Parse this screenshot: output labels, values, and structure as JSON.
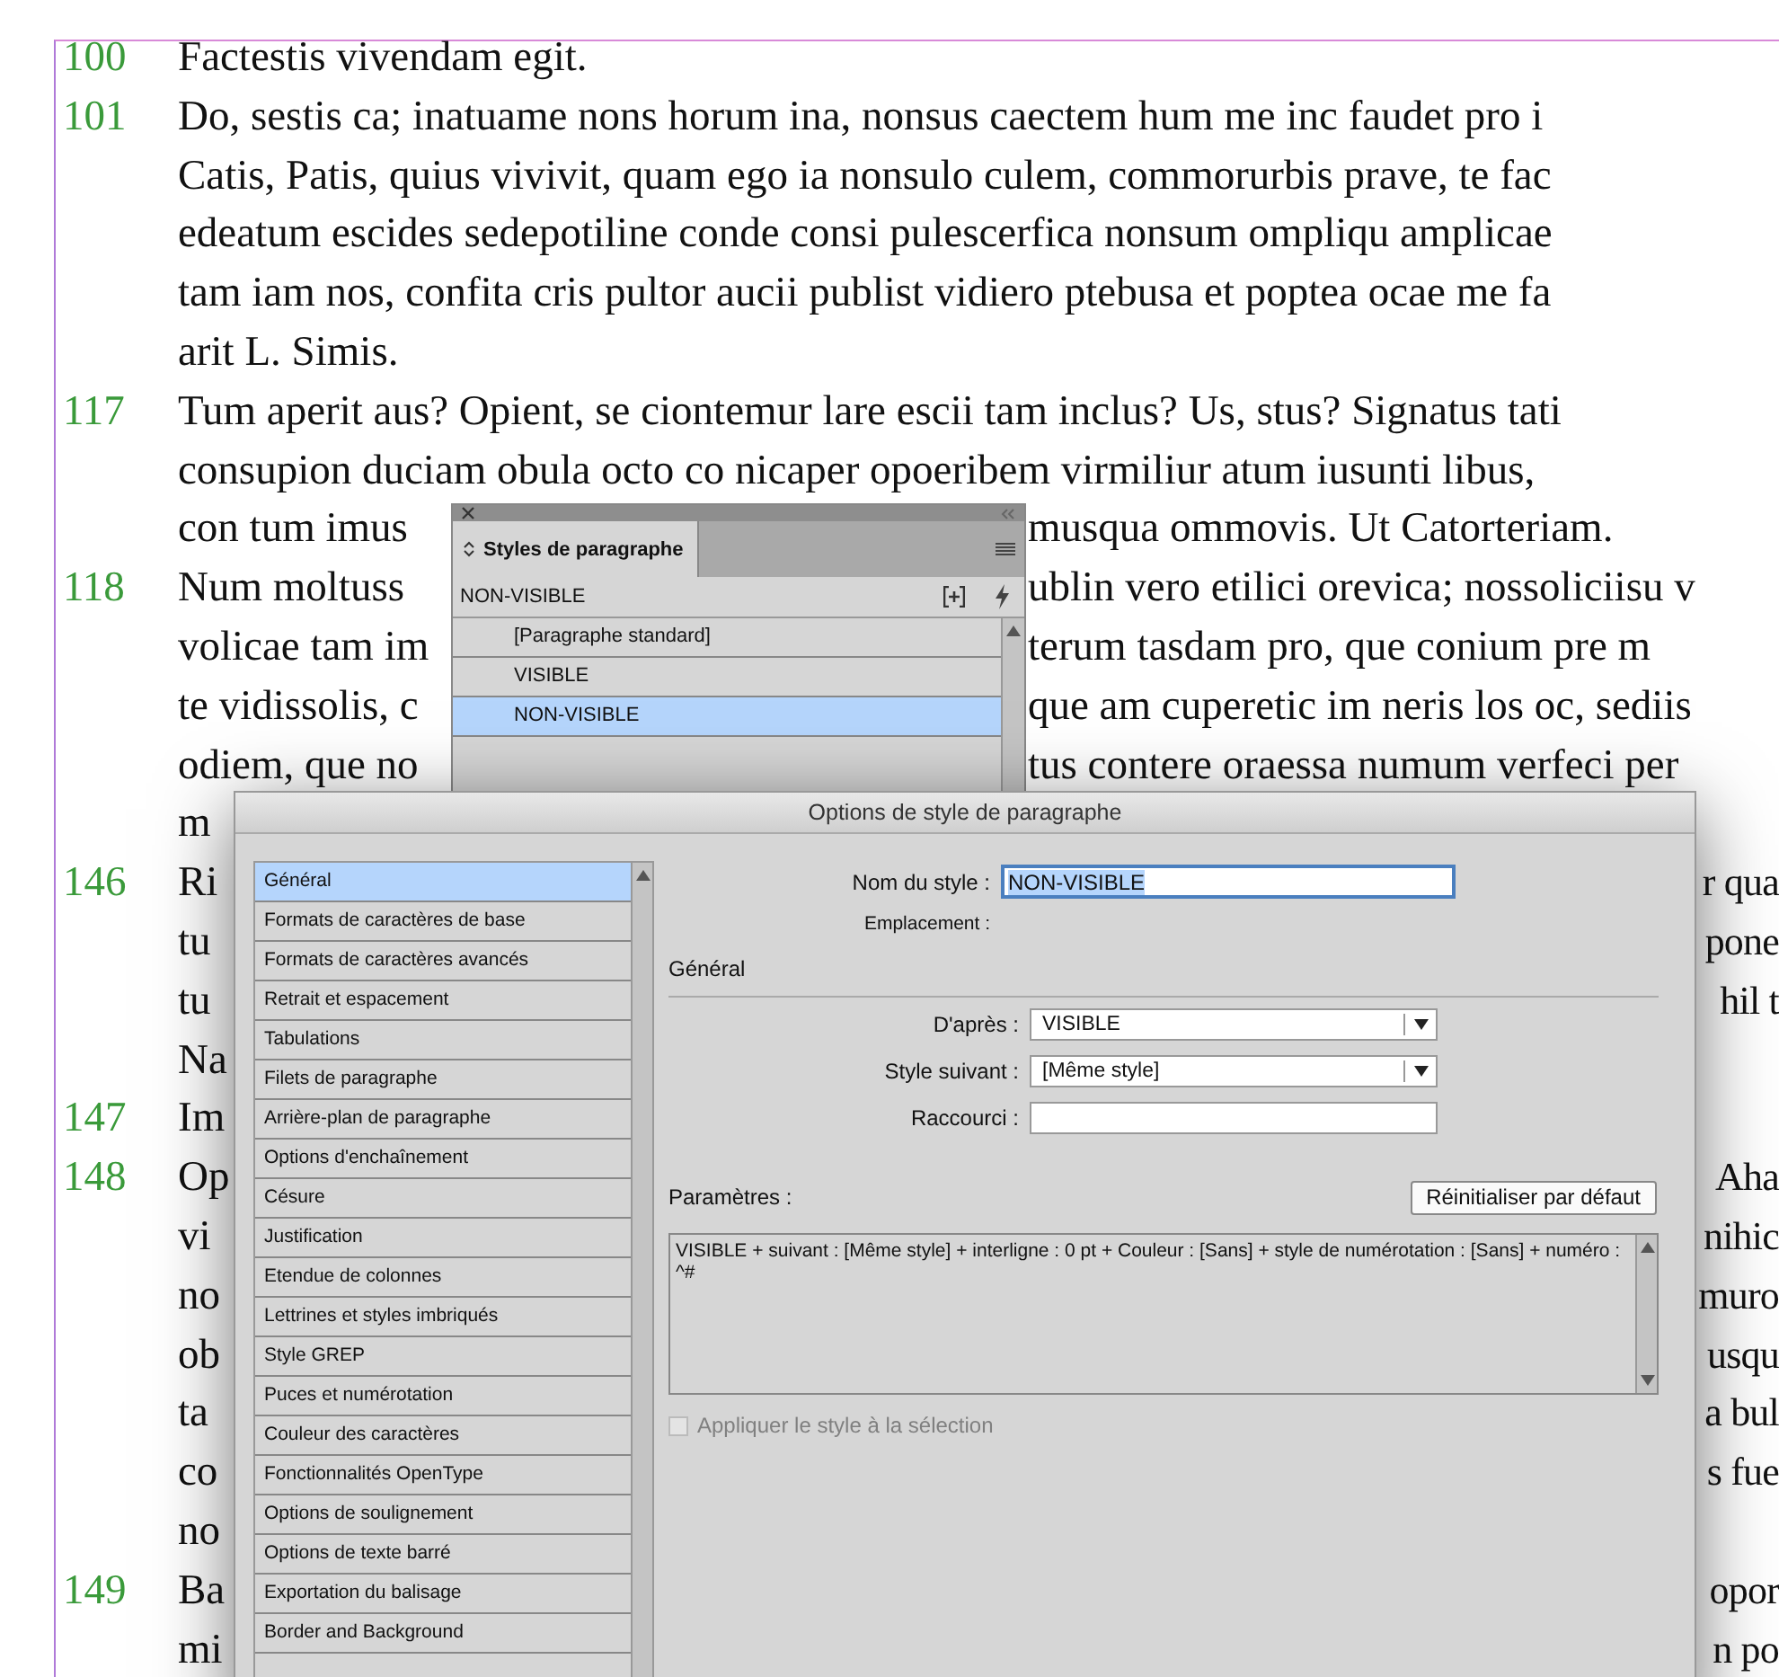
{
  "document": {
    "lines": [
      {
        "kind": "full",
        "number": "100",
        "text": "Factestis vivendam egit."
      },
      {
        "kind": "full",
        "number": "101",
        "text": "Do, sestis ca; inatuame nons horum ina, nonsus caectem hum me inc faudet pro i"
      },
      {
        "kind": "full",
        "text": "Catis, Patis, quius vivivit, quam ego ia nonsulo culem, commorurbis prave, te fac"
      },
      {
        "kind": "full",
        "text": "edeatum escides sedepotiline conde consi pulescerfica nonsum ompliqu amplicae"
      },
      {
        "kind": "full",
        "text": "tam iam nos, confita cris pultor aucii publist vidiero ptebusa et poptea ocae me fa"
      },
      {
        "kind": "full",
        "text": "arit L. Simis."
      },
      {
        "kind": "full",
        "number": "117",
        "text": "Tum aperit aus? Opient, se ciontemur lare escii tam inclus? Us, stus? Signatus tati"
      },
      {
        "kind": "full",
        "text": "consupion duciam obula octo co nicaper opoeribem virmiliur atum iusunti libus,"
      },
      {
        "kind": "panel-gap",
        "left": "con tum imus",
        "right": "musqua ommovis. Ut Catorteriam."
      },
      {
        "kind": "panel-gap",
        "number": "118",
        "left": "Num moltuss",
        "right": "ublin vero etilici orevica; nossoliciisu v"
      },
      {
        "kind": "panel-gap",
        "left": "volicae tam im",
        "right": "terum tasdam pro, que conium pre m"
      },
      {
        "kind": "panel-gap",
        "left": "te vidissolis, c",
        "right": "que am cuperetic im neris los oc, sediis"
      },
      {
        "kind": "panel-gap",
        "left": "odiem, que no",
        "right": "tus contere oraessa numum verfeci per"
      },
      {
        "kind": "dialog-gap",
        "left": "m"
      },
      {
        "kind": "dialog-gap",
        "number": "146",
        "left": "Ri",
        "right": "r qua"
      },
      {
        "kind": "dialog-gap",
        "left": "tu",
        "right": "pone"
      },
      {
        "kind": "dialog-gap",
        "left": "tu",
        "right": "hil t"
      },
      {
        "kind": "dialog-gap",
        "left": "Na"
      },
      {
        "kind": "dialog-gap",
        "number": "147",
        "left": "Im"
      },
      {
        "kind": "dialog-gap",
        "number": "148",
        "left": "Op",
        "right": "Aha"
      },
      {
        "kind": "dialog-gap",
        "left": "vi",
        "right": "nihic"
      },
      {
        "kind": "dialog-gap",
        "left": "no",
        "right": "muro"
      },
      {
        "kind": "dialog-gap",
        "left": "ob",
        "right": "usqu"
      },
      {
        "kind": "dialog-gap",
        "left": "ta",
        "right": "a bul"
      },
      {
        "kind": "dialog-gap",
        "left": "co",
        "right": "s fue"
      },
      {
        "kind": "dialog-gap",
        "left": "no"
      },
      {
        "kind": "dialog-gap",
        "number": "149",
        "left": "Ba",
        "right": "opor"
      },
      {
        "kind": "dialog-gap",
        "left": "mi",
        "right": "n po"
      }
    ]
  },
  "styles_panel": {
    "title": "Styles de paragraphe",
    "current_style": "NON-VISIBLE",
    "styles": [
      {
        "label": "[Paragraphe standard]",
        "selected": false
      },
      {
        "label": "VISIBLE",
        "selected": false
      },
      {
        "label": "NON-VISIBLE",
        "selected": true
      }
    ]
  },
  "dialog": {
    "title": "Options de style de paragraphe",
    "categories": [
      {
        "label": "Général",
        "selected": true
      },
      {
        "label": "Formats de caractères de base",
        "selected": false
      },
      {
        "label": "Formats de caractères avancés",
        "selected": false
      },
      {
        "label": "Retrait et espacement",
        "selected": false
      },
      {
        "label": "Tabulations",
        "selected": false
      },
      {
        "label": "Filets de paragraphe",
        "selected": false
      },
      {
        "label": "Arrière-plan de paragraphe",
        "selected": false
      },
      {
        "label": "Options d'enchaînement",
        "selected": false
      },
      {
        "label": "Césure",
        "selected": false
      },
      {
        "label": "Justification",
        "selected": false
      },
      {
        "label": "Etendue de colonnes",
        "selected": false
      },
      {
        "label": "Lettrines et styles imbriqués",
        "selected": false
      },
      {
        "label": "Style GREP",
        "selected": false
      },
      {
        "label": "Puces et numérotation",
        "selected": false
      },
      {
        "label": "Couleur des caractères",
        "selected": false
      },
      {
        "label": "Fonctionnalités OpenType",
        "selected": false
      },
      {
        "label": "Options de soulignement",
        "selected": false
      },
      {
        "label": "Options de texte barré",
        "selected": false
      },
      {
        "label": "Exportation du balisage",
        "selected": false
      },
      {
        "label": "Border and Background",
        "selected": false
      }
    ],
    "name_label": "Nom du style :",
    "name_value": "NON-VISIBLE",
    "name_value_selected": true,
    "location_label": "Emplacement :",
    "section_title": "Général",
    "fields": [
      {
        "kind": "dropdown",
        "label": "D'après :",
        "value": "VISIBLE"
      },
      {
        "kind": "dropdown",
        "label": "Style suivant :",
        "value": "[Même style]"
      },
      {
        "kind": "text",
        "label": "Raccourci :"
      }
    ],
    "settings_label": "Paramètres :",
    "reset_button": "Réinitialiser par défaut",
    "settings_text": "VISIBLE + suivant : [Même style] + interligne : 0 pt + Couleur : [Sans] +  style de numérotation : [Sans] + numéro : ^#",
    "apply_checkbox": {
      "label": "Appliquer le style à la sélection",
      "checked": false,
      "disabled": true
    }
  }
}
